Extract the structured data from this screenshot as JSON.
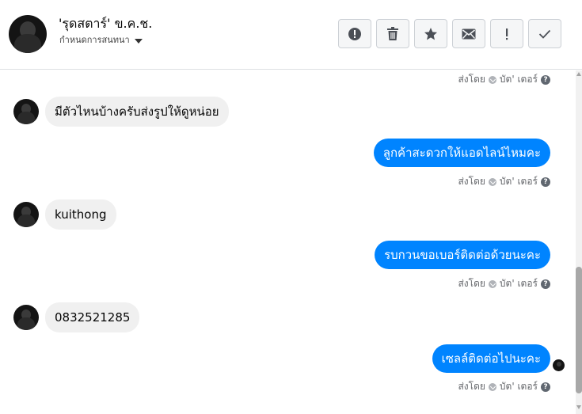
{
  "header": {
    "title": "'รุดสตาร์' ข.ค.ช.",
    "subtitle": "กำหนดการสนทนา",
    "toolbar": [
      {
        "name": "report-button",
        "icon": "alert-circle-icon"
      },
      {
        "name": "delete-button",
        "icon": "trash-icon"
      },
      {
        "name": "star-button",
        "icon": "star-icon"
      },
      {
        "name": "mark-unread-button",
        "icon": "envelope-icon"
      },
      {
        "name": "spam-button",
        "icon": "exclamation-icon"
      },
      {
        "name": "done-button",
        "icon": "check-icon"
      }
    ]
  },
  "thread": {
    "sent_meta": {
      "label": "ส่งโดย",
      "sender": "บัต' เตอร์",
      "help": "?"
    },
    "messages": [
      {
        "direction": "in",
        "text": "มีตัวไหนบ้างครับส่งรูปให้ดูหน่อย"
      },
      {
        "direction": "out",
        "text": "ลูกค้าสะดวกให้แอดไลน์ไหมคะ"
      },
      {
        "direction": "in",
        "text": "kuithong"
      },
      {
        "direction": "out",
        "text": "รบกวนขอเบอร์ติดต่อด้วยนะคะ"
      },
      {
        "direction": "in",
        "text": "0832521285"
      },
      {
        "direction": "out",
        "text": "เซลล์ติดต่อไปนะคะ"
      }
    ]
  },
  "colors": {
    "outgoing_bubble": "#0084ff",
    "incoming_bubble": "#f0f0f0",
    "meta_text": "#65676b"
  }
}
